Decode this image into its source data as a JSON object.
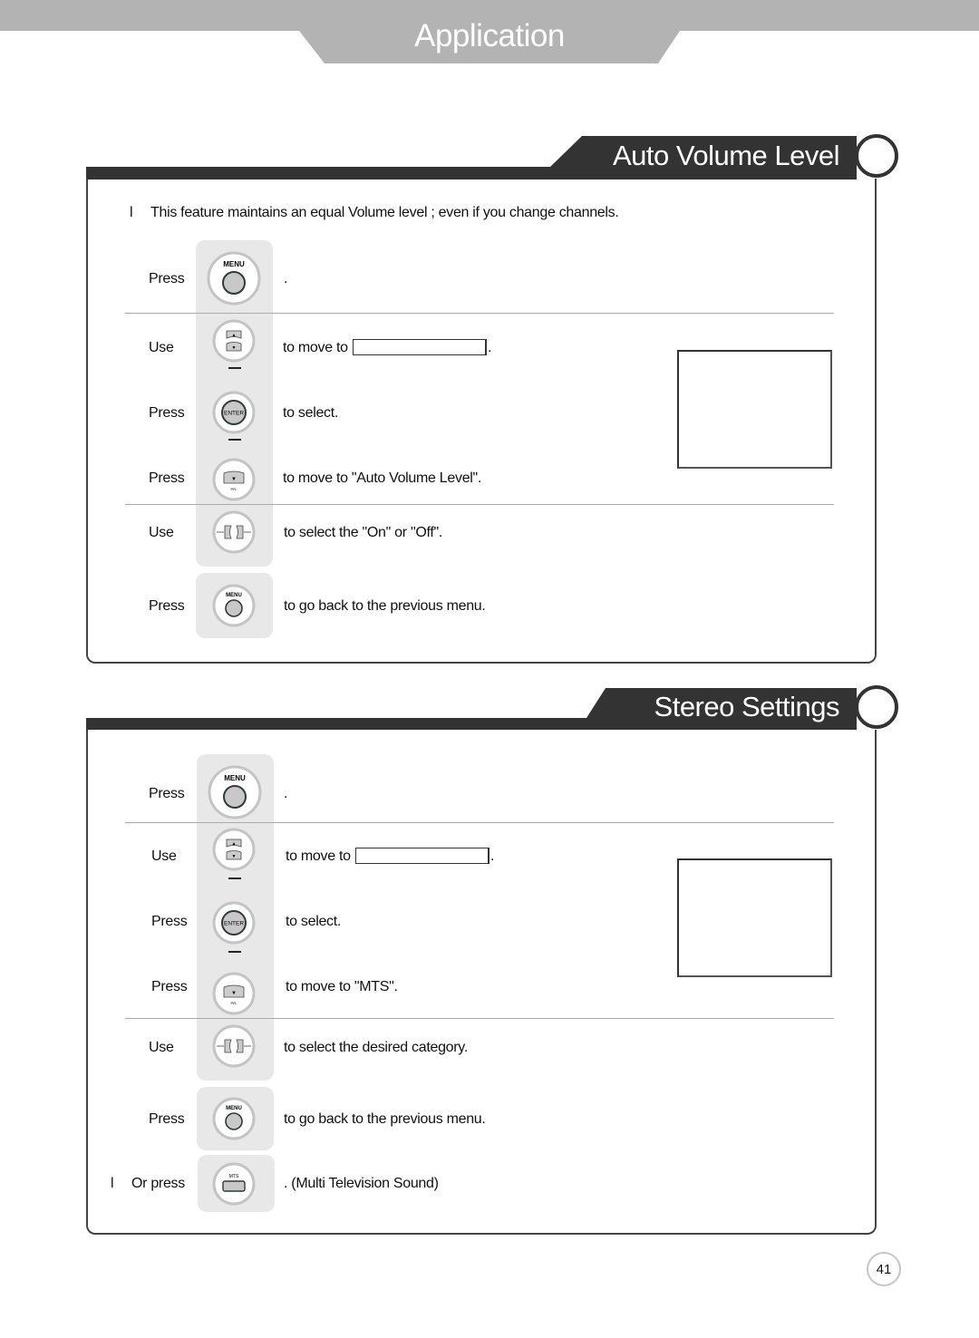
{
  "header": {
    "title": "Application"
  },
  "sections": [
    {
      "title": "Auto Volume Level",
      "bullet": "l",
      "intro": "This feature maintains an equal Volume level ; even if you change channels.",
      "steps": [
        {
          "verb": "Press",
          "key": "menu-button",
          "key_label": "MENU",
          "text": "."
        },
        {
          "verb": "Use",
          "key": "up-down-button",
          "key_label": "PR+ / PR-",
          "text": "to move to",
          "after_field": "."
        },
        {
          "verb": "Press",
          "key": "enter-button",
          "key_label": "ENTER",
          "text": "to select."
        },
        {
          "verb": "Press",
          "key": "down-button",
          "key_label": "PR-",
          "text": "to move to  \"Auto Volume Level\"."
        },
        {
          "verb": "Use",
          "key": "left-right-button",
          "key_label": "VOL- / VOL+",
          "text": "to select the \"On\" or \"Off\"."
        },
        {
          "verb": "Press",
          "key": "menu-button",
          "key_label": "MENU",
          "text": "to go back to the previous menu."
        }
      ]
    },
    {
      "title": "Stereo Settings",
      "bullet": "l",
      "steps": [
        {
          "verb": "Press",
          "key": "menu-button",
          "key_label": "MENU",
          "text": "."
        },
        {
          "verb": "Use",
          "key": "up-down-button",
          "key_label": "PR+ / PR-",
          "text": "to move to",
          "after_field": "."
        },
        {
          "verb": "Press",
          "key": "enter-button",
          "key_label": "ENTER",
          "text": "to select."
        },
        {
          "verb": "Press",
          "key": "down-button",
          "key_label": "PR-",
          "text": "to move to  \"MTS\"."
        },
        {
          "verb": "Use",
          "key": "left-right-button",
          "key_label": "VOL- / VOL+",
          "text": "to select the desired category."
        },
        {
          "verb": "Press",
          "key": "menu-button",
          "key_label": "MENU",
          "text": "to go back to the previous menu."
        }
      ],
      "alt": {
        "verb": "Or press",
        "key": "mts-button",
        "key_label": "MTS",
        "text": ".  (Multi Television Sound)"
      }
    }
  ],
  "footer": {
    "page_number": "41"
  }
}
